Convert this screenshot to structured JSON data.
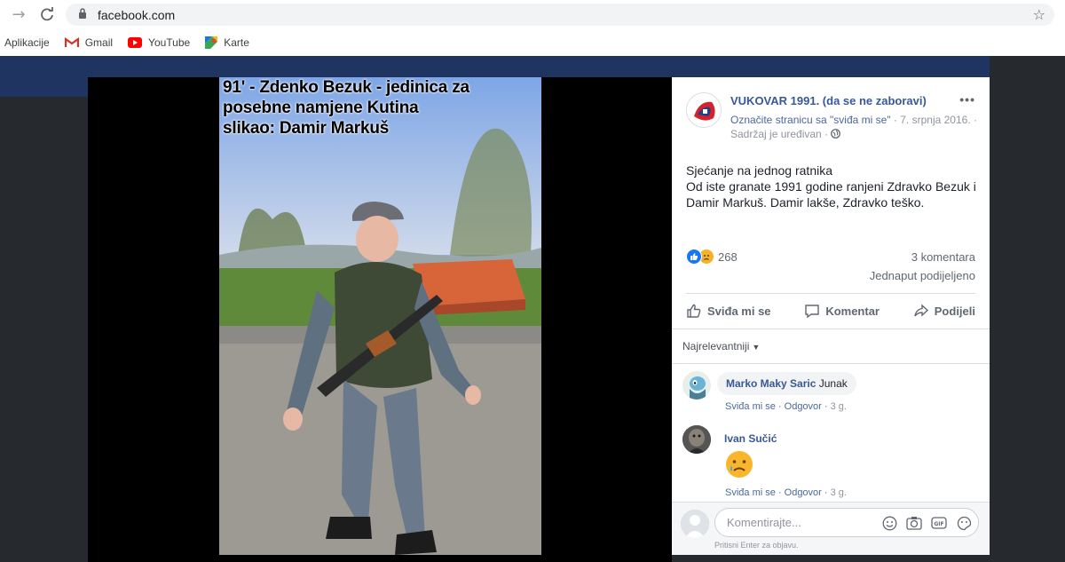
{
  "browser": {
    "url": "facebook.com",
    "bookmarks": [
      {
        "label": "Aplikacije",
        "icon": "apps-icon"
      },
      {
        "label": "Gmail",
        "icon": "gmail-icon"
      },
      {
        "label": "YouTube",
        "icon": "youtube-icon"
      },
      {
        "label": "Karte",
        "icon": "maps-icon"
      }
    ]
  },
  "photo": {
    "caption_lines": [
      "91' - Zdenko Bezuk - jedinica za",
      "posebne namjene Kutina",
      "slikao: Damir Markuš"
    ]
  },
  "post": {
    "page_name": "VUKOVAR 1991. (da se ne zaboravi)",
    "more": "•••",
    "like_page": "Označite stranicu sa \"sviđa mi se\"",
    "date": " · 7. srpnja 2016. ·",
    "edited": "Sadržaj je uređivan ·",
    "text_lines": [
      "Sjećanje na jednog ratnika",
      "Od iste granate 1991 godine ranjeni Zdravko Bezuk i",
      "Damir Markuš. Damir lakše, Zdravko teško."
    ],
    "reactions_count": "268",
    "comments_count": "3 komentara",
    "shares": "Jednaput podijeljeno",
    "actions": {
      "like": "Sviđa mi se",
      "comment": "Komentar",
      "share": "Podijeli"
    },
    "sort_label": "Najrelevantniji"
  },
  "comments": [
    {
      "author": "Marko Maky Saric",
      "text": " Junak",
      "like": "Sviđa mi se",
      "reply": "Odgovor",
      "time": "3 g."
    },
    {
      "author": "Ivan Sučić",
      "text": "",
      "like": "Sviđa mi se",
      "reply": "Odgovor",
      "time": "3 g."
    }
  ],
  "composer": {
    "placeholder": "Komentirajte...",
    "hint": "Pritisni Enter za objavu."
  },
  "colors": {
    "fb_blue": "#385898",
    "accent": "#1877f2"
  }
}
